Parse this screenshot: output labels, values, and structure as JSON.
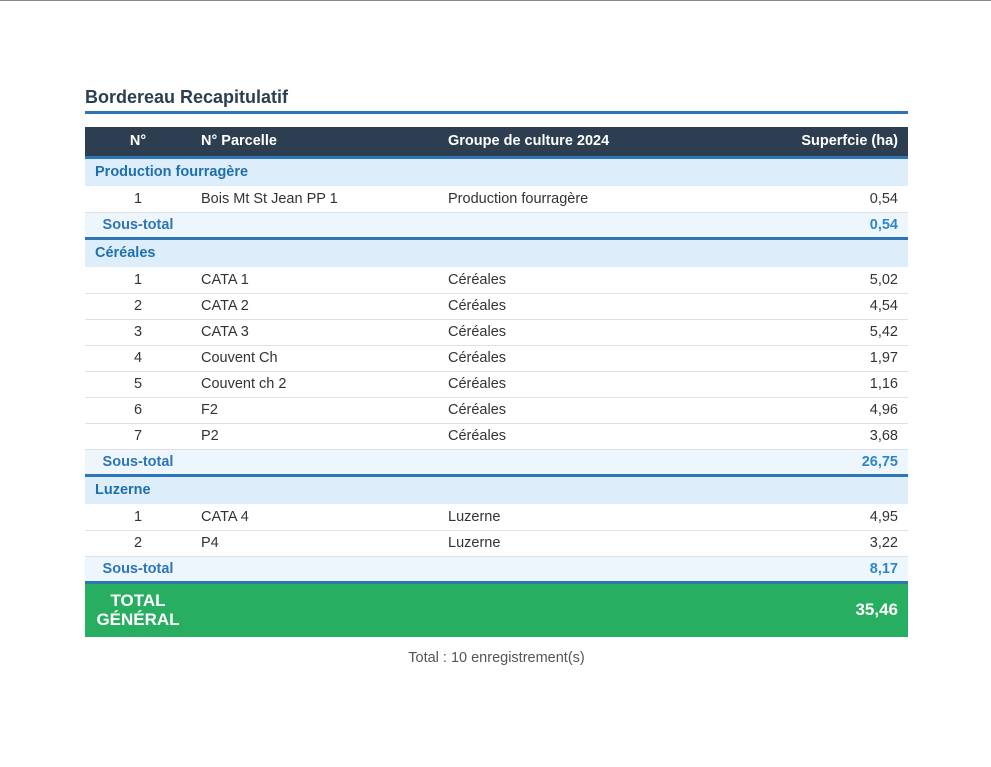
{
  "report": {
    "title": "Bordereau Recapitulatif",
    "columns": [
      "N°",
      "N° Parcelle",
      "Groupe de culture 2024",
      "Superfcie (ha)"
    ],
    "groups": [
      {
        "name": "Production fourragère",
        "rows": [
          {
            "n": "1",
            "parcelle": "Bois Mt St Jean PP 1",
            "groupe": "Production fourragère",
            "surface": "0,54"
          }
        ],
        "subtotal_label": "Sous-total",
        "subtotal_value": "0,54"
      },
      {
        "name": "Céréales",
        "rows": [
          {
            "n": "1",
            "parcelle": "CATA 1",
            "groupe": "Céréales",
            "surface": "5,02"
          },
          {
            "n": "2",
            "parcelle": "CATA 2",
            "groupe": "Céréales",
            "surface": "4,54"
          },
          {
            "n": "3",
            "parcelle": "CATA 3",
            "groupe": "Céréales",
            "surface": "5,42"
          },
          {
            "n": "4",
            "parcelle": "Couvent Ch",
            "groupe": "Céréales",
            "surface": "1,97"
          },
          {
            "n": "5",
            "parcelle": "Couvent ch 2",
            "groupe": "Céréales",
            "surface": "1,16"
          },
          {
            "n": "6",
            "parcelle": "F2",
            "groupe": "Céréales",
            "surface": "4,96"
          },
          {
            "n": "7",
            "parcelle": "P2",
            "groupe": "Céréales",
            "surface": "3,68"
          }
        ],
        "subtotal_label": "Sous-total",
        "subtotal_value": "26,75"
      },
      {
        "name": "Luzerne",
        "rows": [
          {
            "n": "1",
            "parcelle": "CATA 4",
            "groupe": "Luzerne",
            "surface": "4,95"
          },
          {
            "n": "2",
            "parcelle": "P4",
            "groupe": "Luzerne",
            "surface": "3,22"
          }
        ],
        "subtotal_label": "Sous-total",
        "subtotal_value": "8,17"
      }
    ],
    "grand_total": {
      "label_line1": "TOTAL",
      "label_line2": "GÉNÉRAL",
      "value": "35,46"
    },
    "footer_note": "Total : 10 enregistrement(s)"
  },
  "colors": {
    "header_bg": "#2c3e50",
    "accent": "#2e75b6",
    "group_bg": "#ddeefa",
    "grand_total_bg": "#27ae60"
  }
}
